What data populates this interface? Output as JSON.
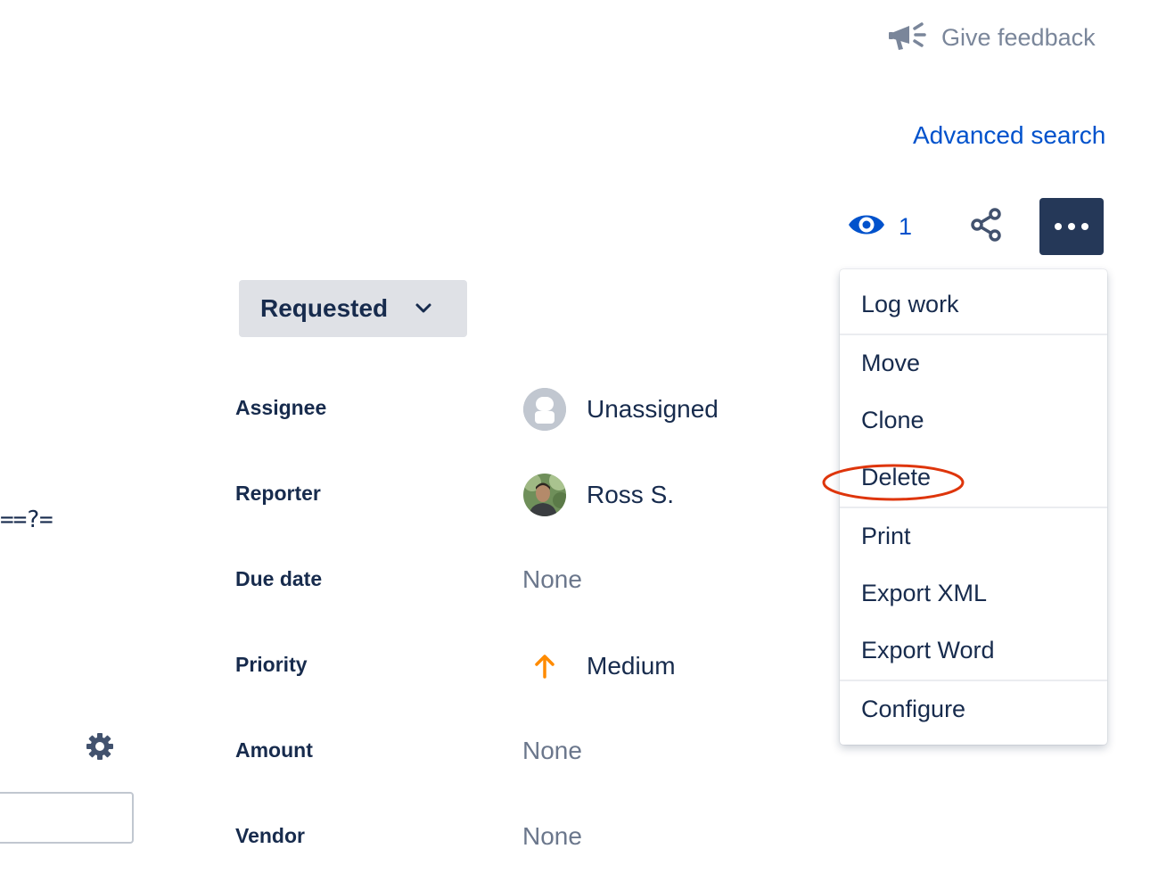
{
  "header": {
    "feedback_label": "Give feedback",
    "feedback_icon": "megaphone-icon",
    "advanced_search_label": "Advanced search"
  },
  "actions": {
    "watch_icon": "eye-icon",
    "watch_count": "1",
    "share_icon": "share-icon",
    "more_icon": "more-horizontal-icon"
  },
  "status": {
    "label": "Requested",
    "icon": "chevron-down-icon"
  },
  "fields": {
    "assignee": {
      "label": "Assignee",
      "value": "Unassigned",
      "icon": "user-avatar-icon"
    },
    "reporter": {
      "label": "Reporter",
      "value": "Ross S.",
      "icon": "user-photo-avatar"
    },
    "due_date": {
      "label": "Due date",
      "value": "None"
    },
    "priority": {
      "label": "Priority",
      "value": "Medium",
      "icon": "arrow-up-icon",
      "color": "#ff8b00"
    },
    "amount": {
      "label": "Amount",
      "value": "None"
    },
    "vendor": {
      "label": "Vendor",
      "value": "None"
    }
  },
  "left_panel": {
    "fragment_text": "==?=",
    "gear_icon": "gear-icon"
  },
  "menu": {
    "items": [
      "Log work",
      "Move",
      "Clone",
      "Delete",
      "Print",
      "Export XML",
      "Export Word",
      "Configure"
    ],
    "highlighted": "Delete",
    "highlight_color": "#de350b"
  },
  "colors": {
    "link": "#0052cc",
    "dark_button": "#253858",
    "text": "#172b4d",
    "muted": "#6b778c"
  }
}
